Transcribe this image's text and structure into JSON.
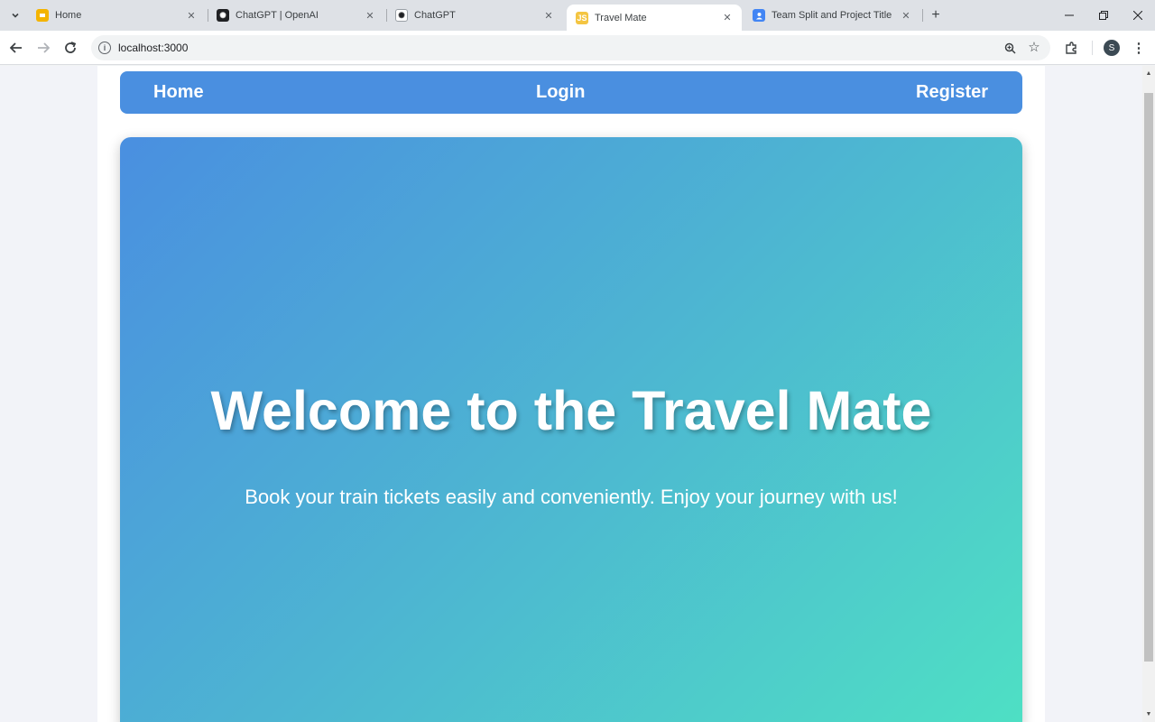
{
  "browser": {
    "tabs": [
      {
        "title": "Home",
        "favicon": "slides-icon",
        "color": "#f4b400",
        "active": false
      },
      {
        "title": "ChatGPT | OpenAI",
        "favicon": "openai-icon",
        "color": "#202124",
        "active": false
      },
      {
        "title": "ChatGPT",
        "favicon": "openai-icon",
        "color": "#ffffff",
        "active": false
      },
      {
        "title": "Travel Mate",
        "favicon": "react-js-icon",
        "color": "#f4c542",
        "active": true
      },
      {
        "title": "Team Split and Project Title",
        "favicon": "user-icon",
        "color": "#4285f4",
        "active": false
      }
    ],
    "address": {
      "url": "localhost:3000"
    },
    "profile_initial": "S"
  },
  "page": {
    "nav": {
      "home": "Home",
      "login": "Login",
      "register": "Register"
    },
    "hero": {
      "title": "Welcome to the Travel Mate",
      "subtitle": "Book your train tickets easily and conveniently. Enjoy your journey with us!"
    },
    "colors": {
      "navbar": "#4a8fe0",
      "gradient_start": "#4a8fe0",
      "gradient_end": "#4ee0c4"
    }
  }
}
